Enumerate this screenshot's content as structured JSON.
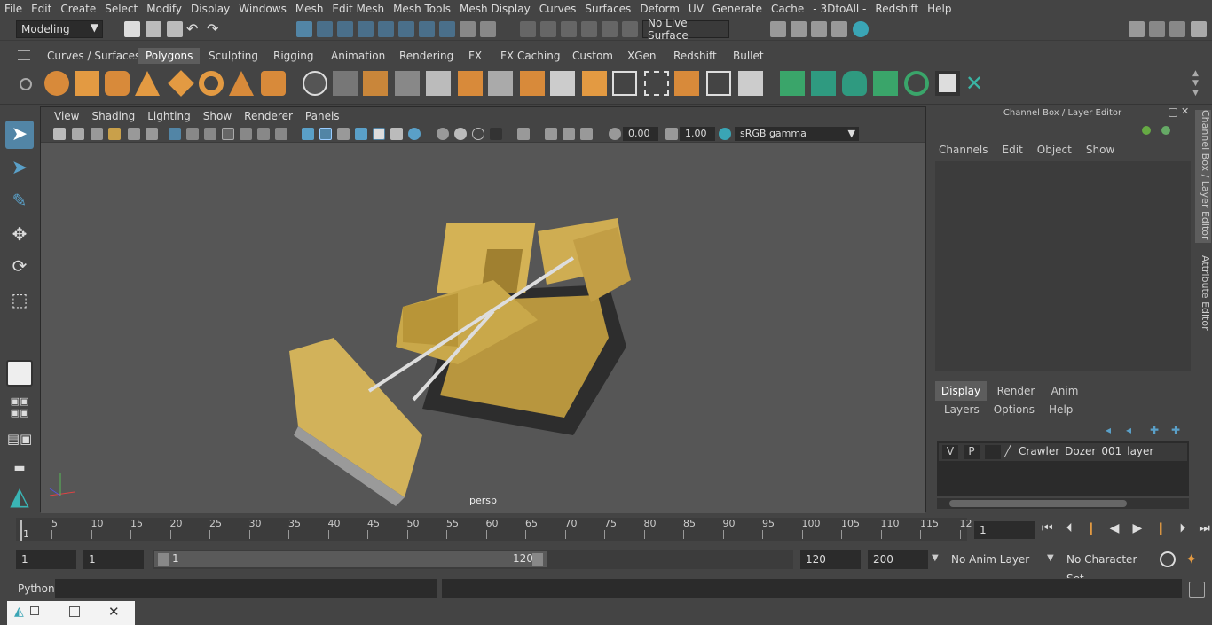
{
  "menubar": [
    "File",
    "Edit",
    "Create",
    "Select",
    "Modify",
    "Display",
    "Windows",
    "Mesh",
    "Edit Mesh",
    "Mesh Tools",
    "Mesh Display",
    "Curves",
    "Surfaces",
    "Deform",
    "UV",
    "Generate",
    "Cache",
    "- 3DtoAll -",
    "Redshift",
    "Help"
  ],
  "status": {
    "mode": "Modeling",
    "live_surface": "No Live Surface"
  },
  "shelf_tabs": [
    "Curves / Surfaces",
    "Polygons",
    "Sculpting",
    "Rigging",
    "Animation",
    "Rendering",
    "FX",
    "FX Caching",
    "Custom",
    "XGen",
    "Redshift",
    "Bullet"
  ],
  "shelf_active": "Polygons",
  "viewport": {
    "menu": [
      "View",
      "Shading",
      "Lighting",
      "Show",
      "Renderer",
      "Panels"
    ],
    "exposure": "0.00",
    "gamma": "1.00",
    "color_space": "sRGB gamma",
    "camera": "persp"
  },
  "channel_box": {
    "title": "Channel Box / Layer Editor",
    "menu": [
      "Channels",
      "Edit",
      "Object",
      "Show"
    ],
    "tabs": [
      "Display",
      "Render",
      "Anim"
    ],
    "active_tab": "Display",
    "layer_menu": [
      "Layers",
      "Options",
      "Help"
    ],
    "layer": {
      "v": "V",
      "p": "P",
      "name": "Crawler_Dozer_001_layer"
    }
  },
  "side_tabs": [
    "Channel Box / Layer Editor",
    "Attribute Editor"
  ],
  "timeline": {
    "ticks": [
      "5",
      "10",
      "15",
      "20",
      "25",
      "30",
      "35",
      "40",
      "45",
      "50",
      "55",
      "60",
      "65",
      "70",
      "75",
      "80",
      "85",
      "90",
      "95",
      "100",
      "105",
      "110",
      "115",
      "12"
    ],
    "start_label": "1",
    "current_frame": "1"
  },
  "range": {
    "start": "1",
    "playback_start": "1",
    "slider_start": "1",
    "slider_end": "120",
    "playback_end": "120",
    "end": "200",
    "anim_layer": "No Anim Layer",
    "character_set": "No Character Set"
  },
  "cmdline": {
    "label": "Python"
  },
  "colors": {
    "accent": "#5285a6",
    "panel": "#444444",
    "field": "#2b2b2b",
    "model": "#c9a84a"
  }
}
